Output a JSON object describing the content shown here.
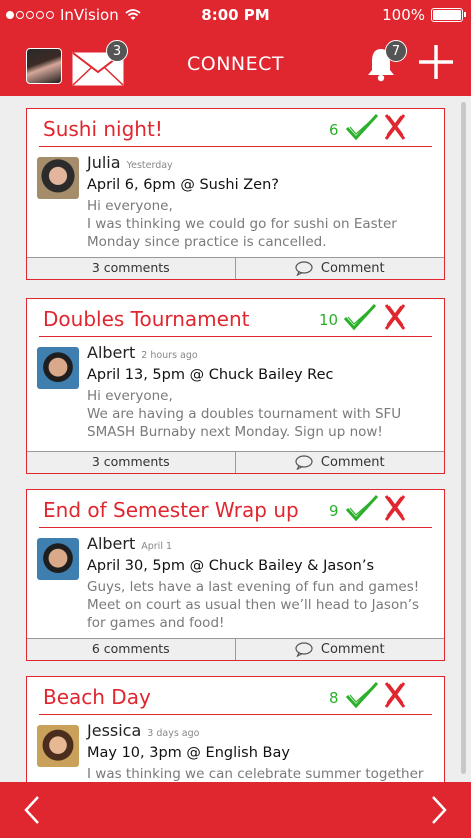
{
  "status": {
    "carrier": "InVision",
    "time": "8:00 PM",
    "battery": "100%",
    "signal_bars": 5,
    "signal_full": 1
  },
  "nav": {
    "title": "CONNECT",
    "mail_count": "3",
    "notification_count": "7"
  },
  "posts": [
    {
      "title": "Sushi night!",
      "attending": "6",
      "author": "Julia",
      "time": "Yesterday",
      "event": "April 6, 6pm @ Sushi Zen?",
      "message": "Hi everyone,\nI was thinking we could go for sushi on Easter Monday since practice is cancelled.",
      "comments": "3 comments",
      "comment_label": "Comment"
    },
    {
      "title": "Doubles Tournament",
      "attending": "10",
      "author": "Albert",
      "time": "2 hours ago",
      "event": "April 13, 5pm @ Chuck Bailey Rec",
      "message": "Hi everyone,\nWe are having a doubles tournament with SFU SMASH Burnaby next Monday. Sign up now!",
      "comments": "3 comments",
      "comment_label": "Comment"
    },
    {
      "title": "End of Semester Wrap up",
      "attending": "9",
      "author": "Albert",
      "time": "April 1",
      "event": "April 30, 5pm @ Chuck Bailey & Jason’s",
      "message": "Guys, lets have a last evening of fun and games! Meet on court as usual then we’ll head to Jason’s for games and food!",
      "comments": "6 comments",
      "comment_label": "Comment"
    },
    {
      "title": "Beach Day",
      "attending": "8",
      "author": "Jessica",
      "time": "3 days ago",
      "event": "May 10, 3pm @ English Bay",
      "message": "I was thinking we can celebrate summer together",
      "comments": "",
      "comment_label": ""
    }
  ],
  "colors": {
    "accent": "#e0262f",
    "going": "#2bb02b"
  },
  "icons": [
    "wifi-icon",
    "mail-icon",
    "bell-icon",
    "plus-icon",
    "check-icon",
    "cross-icon",
    "speech-bubble-icon",
    "chevron-left-icon",
    "chevron-right-icon"
  ]
}
